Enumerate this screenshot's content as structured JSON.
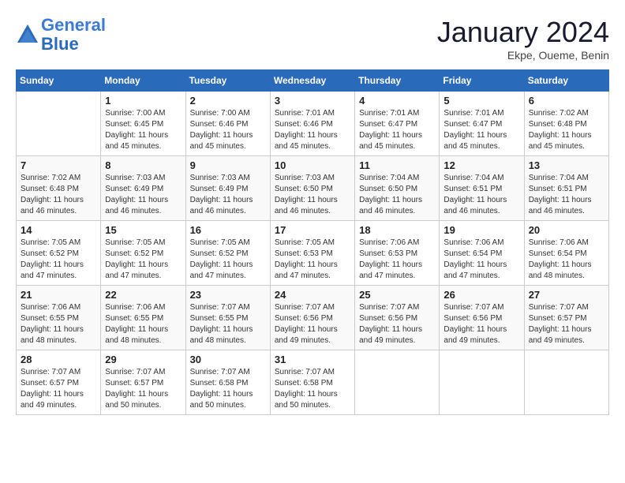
{
  "logo": {
    "line1": "General",
    "line2": "Blue"
  },
  "title": "January 2024",
  "location": "Ekpe, Oueme, Benin",
  "weekdays": [
    "Sunday",
    "Monday",
    "Tuesday",
    "Wednesday",
    "Thursday",
    "Friday",
    "Saturday"
  ],
  "weeks": [
    [
      {
        "day": "",
        "sunrise": "",
        "sunset": "",
        "daylight": ""
      },
      {
        "day": "1",
        "sunrise": "Sunrise: 7:00 AM",
        "sunset": "Sunset: 6:45 PM",
        "daylight": "Daylight: 11 hours and 45 minutes."
      },
      {
        "day": "2",
        "sunrise": "Sunrise: 7:00 AM",
        "sunset": "Sunset: 6:46 PM",
        "daylight": "Daylight: 11 hours and 45 minutes."
      },
      {
        "day": "3",
        "sunrise": "Sunrise: 7:01 AM",
        "sunset": "Sunset: 6:46 PM",
        "daylight": "Daylight: 11 hours and 45 minutes."
      },
      {
        "day": "4",
        "sunrise": "Sunrise: 7:01 AM",
        "sunset": "Sunset: 6:47 PM",
        "daylight": "Daylight: 11 hours and 45 minutes."
      },
      {
        "day": "5",
        "sunrise": "Sunrise: 7:01 AM",
        "sunset": "Sunset: 6:47 PM",
        "daylight": "Daylight: 11 hours and 45 minutes."
      },
      {
        "day": "6",
        "sunrise": "Sunrise: 7:02 AM",
        "sunset": "Sunset: 6:48 PM",
        "daylight": "Daylight: 11 hours and 45 minutes."
      }
    ],
    [
      {
        "day": "7",
        "sunrise": "Sunrise: 7:02 AM",
        "sunset": "Sunset: 6:48 PM",
        "daylight": "Daylight: 11 hours and 46 minutes."
      },
      {
        "day": "8",
        "sunrise": "Sunrise: 7:03 AM",
        "sunset": "Sunset: 6:49 PM",
        "daylight": "Daylight: 11 hours and 46 minutes."
      },
      {
        "day": "9",
        "sunrise": "Sunrise: 7:03 AM",
        "sunset": "Sunset: 6:49 PM",
        "daylight": "Daylight: 11 hours and 46 minutes."
      },
      {
        "day": "10",
        "sunrise": "Sunrise: 7:03 AM",
        "sunset": "Sunset: 6:50 PM",
        "daylight": "Daylight: 11 hours and 46 minutes."
      },
      {
        "day": "11",
        "sunrise": "Sunrise: 7:04 AM",
        "sunset": "Sunset: 6:50 PM",
        "daylight": "Daylight: 11 hours and 46 minutes."
      },
      {
        "day": "12",
        "sunrise": "Sunrise: 7:04 AM",
        "sunset": "Sunset: 6:51 PM",
        "daylight": "Daylight: 11 hours and 46 minutes."
      },
      {
        "day": "13",
        "sunrise": "Sunrise: 7:04 AM",
        "sunset": "Sunset: 6:51 PM",
        "daylight": "Daylight: 11 hours and 46 minutes."
      }
    ],
    [
      {
        "day": "14",
        "sunrise": "Sunrise: 7:05 AM",
        "sunset": "Sunset: 6:52 PM",
        "daylight": "Daylight: 11 hours and 47 minutes."
      },
      {
        "day": "15",
        "sunrise": "Sunrise: 7:05 AM",
        "sunset": "Sunset: 6:52 PM",
        "daylight": "Daylight: 11 hours and 47 minutes."
      },
      {
        "day": "16",
        "sunrise": "Sunrise: 7:05 AM",
        "sunset": "Sunset: 6:52 PM",
        "daylight": "Daylight: 11 hours and 47 minutes."
      },
      {
        "day": "17",
        "sunrise": "Sunrise: 7:05 AM",
        "sunset": "Sunset: 6:53 PM",
        "daylight": "Daylight: 11 hours and 47 minutes."
      },
      {
        "day": "18",
        "sunrise": "Sunrise: 7:06 AM",
        "sunset": "Sunset: 6:53 PM",
        "daylight": "Daylight: 11 hours and 47 minutes."
      },
      {
        "day": "19",
        "sunrise": "Sunrise: 7:06 AM",
        "sunset": "Sunset: 6:54 PM",
        "daylight": "Daylight: 11 hours and 47 minutes."
      },
      {
        "day": "20",
        "sunrise": "Sunrise: 7:06 AM",
        "sunset": "Sunset: 6:54 PM",
        "daylight": "Daylight: 11 hours and 48 minutes."
      }
    ],
    [
      {
        "day": "21",
        "sunrise": "Sunrise: 7:06 AM",
        "sunset": "Sunset: 6:55 PM",
        "daylight": "Daylight: 11 hours and 48 minutes."
      },
      {
        "day": "22",
        "sunrise": "Sunrise: 7:06 AM",
        "sunset": "Sunset: 6:55 PM",
        "daylight": "Daylight: 11 hours and 48 minutes."
      },
      {
        "day": "23",
        "sunrise": "Sunrise: 7:07 AM",
        "sunset": "Sunset: 6:55 PM",
        "daylight": "Daylight: 11 hours and 48 minutes."
      },
      {
        "day": "24",
        "sunrise": "Sunrise: 7:07 AM",
        "sunset": "Sunset: 6:56 PM",
        "daylight": "Daylight: 11 hours and 49 minutes."
      },
      {
        "day": "25",
        "sunrise": "Sunrise: 7:07 AM",
        "sunset": "Sunset: 6:56 PM",
        "daylight": "Daylight: 11 hours and 49 minutes."
      },
      {
        "day": "26",
        "sunrise": "Sunrise: 7:07 AM",
        "sunset": "Sunset: 6:56 PM",
        "daylight": "Daylight: 11 hours and 49 minutes."
      },
      {
        "day": "27",
        "sunrise": "Sunrise: 7:07 AM",
        "sunset": "Sunset: 6:57 PM",
        "daylight": "Daylight: 11 hours and 49 minutes."
      }
    ],
    [
      {
        "day": "28",
        "sunrise": "Sunrise: 7:07 AM",
        "sunset": "Sunset: 6:57 PM",
        "daylight": "Daylight: 11 hours and 49 minutes."
      },
      {
        "day": "29",
        "sunrise": "Sunrise: 7:07 AM",
        "sunset": "Sunset: 6:57 PM",
        "daylight": "Daylight: 11 hours and 50 minutes."
      },
      {
        "day": "30",
        "sunrise": "Sunrise: 7:07 AM",
        "sunset": "Sunset: 6:58 PM",
        "daylight": "Daylight: 11 hours and 50 minutes."
      },
      {
        "day": "31",
        "sunrise": "Sunrise: 7:07 AM",
        "sunset": "Sunset: 6:58 PM",
        "daylight": "Daylight: 11 hours and 50 minutes."
      },
      {
        "day": "",
        "sunrise": "",
        "sunset": "",
        "daylight": ""
      },
      {
        "day": "",
        "sunrise": "",
        "sunset": "",
        "daylight": ""
      },
      {
        "day": "",
        "sunrise": "",
        "sunset": "",
        "daylight": ""
      }
    ]
  ]
}
